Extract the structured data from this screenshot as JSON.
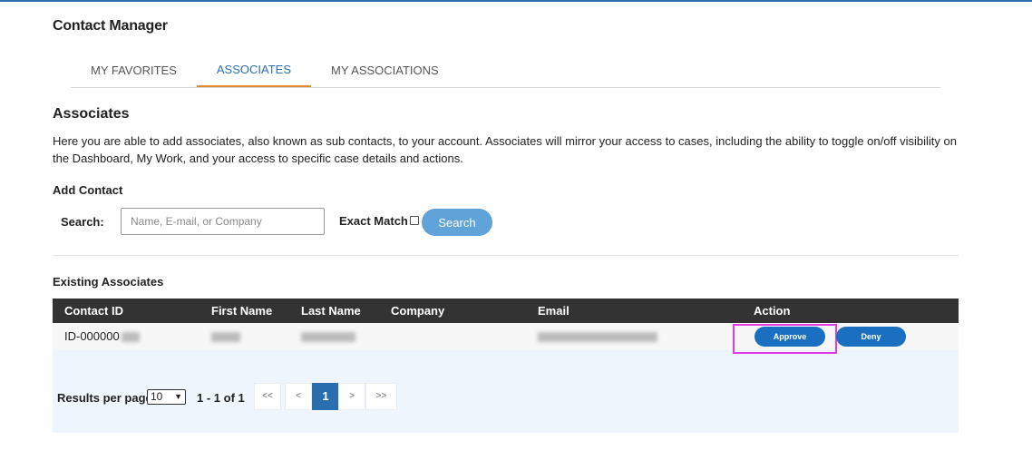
{
  "app": {
    "title": "Contact Manager"
  },
  "tabs": [
    {
      "label": "MY FAVORITES",
      "active": false
    },
    {
      "label": "ASSOCIATES",
      "active": true
    },
    {
      "label": "MY ASSOCIATIONS",
      "active": false
    }
  ],
  "associates": {
    "title": "Associates",
    "description": "Here you are able to add associates, also known as sub contacts, to your account. Associates will mirror your access to cases, including the ability to toggle on/off visibility on the Dashboard, My Work, and your access to specific case details and actions."
  },
  "add_contact": {
    "title": "Add Contact",
    "search_label": "Search:",
    "search_placeholder": "Name, E-mail, or Company",
    "search_value": "",
    "exact_match_label": "Exact Match",
    "exact_match_checked": false,
    "search_button": "Search"
  },
  "existing": {
    "title": "Existing Associates",
    "columns": [
      "Contact ID",
      "First Name",
      "Last Name",
      "Company",
      "Email",
      "Action"
    ],
    "rows": [
      {
        "contact_id": "ID-000000",
        "company": "",
        "approve_label": "Approve",
        "deny_label": "Deny"
      }
    ]
  },
  "pagination": {
    "results_per_page_label": "Results per page",
    "results_per_page_value": "10",
    "range_text": "1 - 1 of 1",
    "first": "<<",
    "prev": "<",
    "current_page": "1",
    "next": ">",
    "last": ">>"
  },
  "colors": {
    "accent_blue": "#2a6fad",
    "tab_underline": "#e0892f",
    "search_button": "#5fa3d8",
    "action_button": "#1a6fc0",
    "highlight": "#e23be6",
    "table_header": "#333333"
  }
}
